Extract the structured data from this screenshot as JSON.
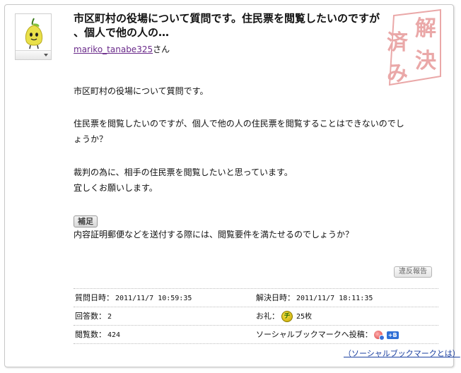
{
  "question": {
    "title": "市区町村の役場について質問です。住民票を閲覧したいのですが、個人で他の人の…",
    "title_line1": "市区町村の役場について質問です。住民票を閲覧したいのですが",
    "title_line2": "、個人で他の人の…",
    "author_name": "mariko_tanabe325",
    "author_suffix": "さん",
    "stamp_text": "解決済み",
    "body": {
      "para1": "市区町村の役場について質問です。",
      "para2_line1": "住民票を閲覧したいのですが、個人で他の人の住民票を閲覧することはできないのでし",
      "para2_line2": "ょうか？",
      "para3_line1": "裁判の為に、相手の住民票を閲覧したいと思っています。",
      "para3_line2": "宜しくお願いします。"
    },
    "supplement_label": "補足",
    "supplement_text": "内容証明郵便などを送付する際には、閲覧要件を満たせるのでしょうか？",
    "report_label": "違反報告"
  },
  "stats": {
    "asked_label": "質問日時：",
    "asked_value": "2011/11/7 10:59:35",
    "resolved_label": "解決日時：",
    "resolved_value": "2011/11/7 18:11:35",
    "answers_label": "回答数：",
    "answers_value": "2",
    "thanks_label": "お礼：",
    "thanks_value": "25枚",
    "views_label": "閲覧数：",
    "views_value": "424",
    "social_label": "ソーシャルブックマークへ投稿："
  },
  "social_bookmark_link": "（ソーシャルブックマークとは）",
  "colors": {
    "author_link": "#6a2a8a",
    "stamp": "#e8a0a0",
    "link": "#1a3fa0"
  }
}
